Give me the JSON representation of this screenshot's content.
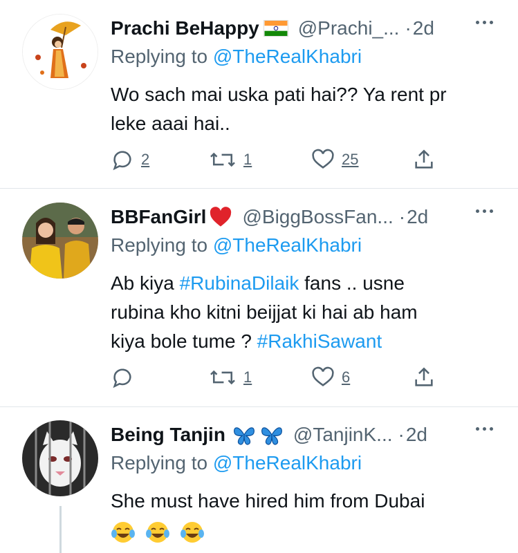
{
  "tweets": [
    {
      "name": "Prachi BeHappy",
      "handle": "@Prachi_...",
      "separator": "·",
      "time": "2d",
      "replying_prefix": "Replying to",
      "replying_to": "@TheRealKhabri",
      "text_lines": [
        "Wo sach mai uska pati hai?? Ya rent pr",
        "leke aaai hai.."
      ],
      "replies": "2",
      "retweets": "1",
      "likes": "25",
      "name_icon": "india-flag-icon"
    },
    {
      "name": "BBFanGirl",
      "handle": "@BiggBossFan...",
      "separator": "·",
      "time": "2d",
      "replying_prefix": "Replying to",
      "replying_to": "@TheRealKhabri",
      "line1_pre": "Ab kiya ",
      "line1_tag": "#RubinaDilaik",
      "line1_post": " fans .. usne",
      "line2": "rubina kho kitni beijjat ki hai ab ham",
      "line3_pre": "kiya bole tume ? ",
      "line3_tag": "#RakhiSawant",
      "replies": "",
      "retweets": "1",
      "likes": "6",
      "name_icon": "red-heart-icon"
    },
    {
      "name": "Being Tanjin",
      "handle": "@TanjinK...",
      "separator": "·",
      "time": "2d",
      "replying_prefix": "Replying to",
      "replying_to": "@TheRealKhabri",
      "text": "She must have hired him from Dubai",
      "name_icon": "blue-butterfly-icon",
      "emojis": [
        "tears-of-joy-emoji",
        "tears-of-joy-emoji",
        "tears-of-joy-emoji"
      ]
    }
  ],
  "colors": {
    "link": "#1d9bf0",
    "secondary": "#536471",
    "text": "#0f1419",
    "divider": "#e1e6ea"
  }
}
